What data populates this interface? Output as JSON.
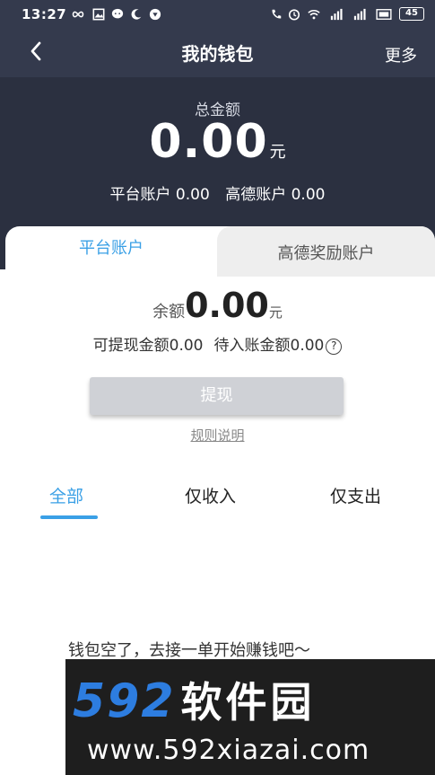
{
  "status_bar": {
    "time": "13:27",
    "battery": "45"
  },
  "nav": {
    "title": "我的钱包",
    "more": "更多"
  },
  "summary": {
    "total_label": "总金额",
    "total_amount": "0.00",
    "total_unit": "元",
    "platform_account": "平台账户 0.00",
    "amap_account": "高德账户 0.00"
  },
  "account_tabs": [
    {
      "label": "平台账户",
      "active": true
    },
    {
      "label": "高德奖励账户",
      "active": false
    }
  ],
  "balance": {
    "label": "余额",
    "amount": "0.00",
    "unit": "元",
    "withdrawable": "可提现金额0.00",
    "pending": "待入账金额0.00",
    "help_symbol": "?"
  },
  "actions": {
    "withdraw": "提现",
    "rules": "规则说明"
  },
  "filter_tabs": [
    {
      "label": "全部",
      "active": true
    },
    {
      "label": "仅收入",
      "active": false
    },
    {
      "label": "仅支出",
      "active": false
    }
  ],
  "empty_message": "钱包空了，去接一单开始赚钱吧～",
  "watermark": {
    "logo_num": "592",
    "logo_cn": "软件园",
    "url": "www.592xiazai.com"
  },
  "colors": {
    "header_dark": "#2b3040",
    "accent": "#3aa0e6",
    "button_disabled": "#cfd1d6"
  }
}
